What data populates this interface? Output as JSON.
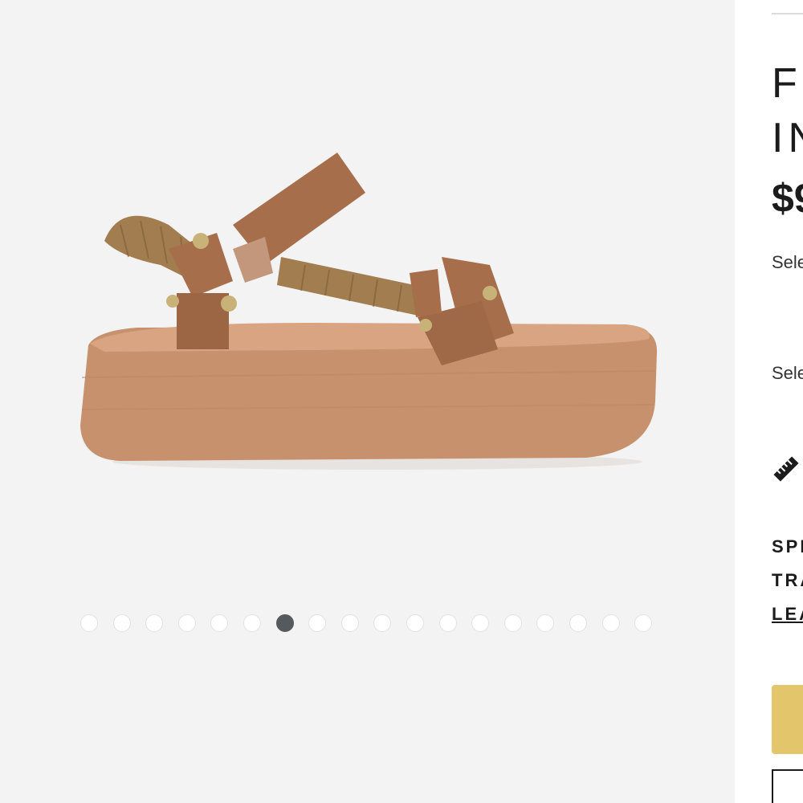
{
  "product": {
    "title": "F\nIN",
    "price": "$9",
    "select_color_label": "Sele",
    "select_size_label": "Sele"
  },
  "promo": {
    "line1": "SPI",
    "line2": "TRA",
    "link": "LEA"
  },
  "gallery": {
    "image_name": "braided platform sandal",
    "dot_count": 18,
    "active_index": 6
  },
  "icons": {
    "size_guide": "ruler-icon"
  },
  "colors": {
    "active_dot": "#555a5f",
    "add_to_cart": "#e3c66c",
    "gallery_bg": "#f3f3f3"
  }
}
